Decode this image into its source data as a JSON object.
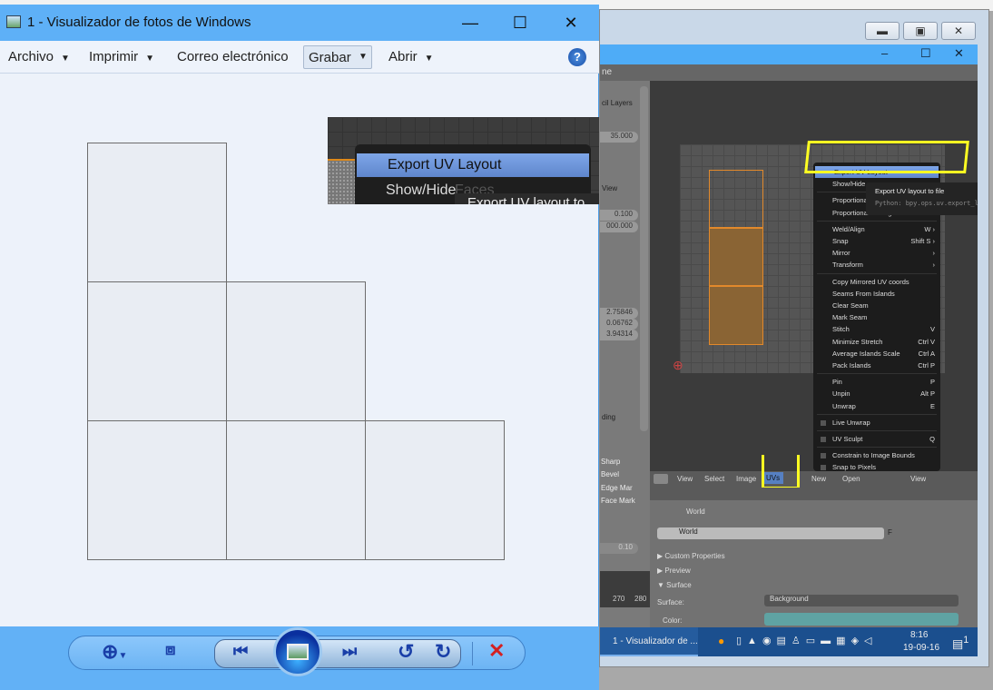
{
  "photo_viewer": {
    "title": "1 - Visualizador de fotos de Windows",
    "window_buttons": {
      "minimize": "—",
      "maximize": "☐",
      "close": "✕"
    },
    "menu": [
      {
        "label": "Archivo",
        "dropdown": true
      },
      {
        "label": "Imprimir",
        "dropdown": true
      },
      {
        "label": "Correo electrónico",
        "dropdown": false
      },
      {
        "label": "Grabar",
        "dropdown": true
      },
      {
        "label": "Abrir",
        "dropdown": true
      }
    ],
    "help": "?",
    "image_crop": {
      "highlighted_item": "Export UV Layout",
      "next_item": "Show/Hide",
      "faded_text": "Faces",
      "tooltip_fragment": "Export UV layout to fil"
    },
    "controls": [
      "zoom",
      "fit",
      "previous",
      "slideshow",
      "next",
      "rotate-left",
      "rotate-right",
      "delete"
    ]
  },
  "blender": {
    "header_fragment": "ne",
    "left_panel": {
      "labels": [
        "cil Layers",
        "View",
        "ding",
        "Sharp",
        "Bevel",
        "Edge Mar",
        "Face Mark"
      ],
      "values": [
        "35.000",
        "0.100",
        "000.000",
        "2.75846",
        "0.06762",
        "3.94314",
        "0.10"
      ]
    },
    "uv_menu": [
      {
        "label": "Export UV Layout",
        "shortcut": "",
        "highlighted": true
      },
      {
        "label": "Show/Hide",
        "shortcut": ""
      },
      {
        "label": "Proportional",
        "shortcut": ""
      },
      {
        "label": "Proportional Editing",
        "shortcut": ""
      },
      {
        "label": "Weld/Align",
        "shortcut": "W ›"
      },
      {
        "label": "Snap",
        "shortcut": "Shift S ›"
      },
      {
        "label": "Mirror",
        "shortcut": "›"
      },
      {
        "label": "Transform",
        "shortcut": "›"
      },
      {
        "label": "Copy Mirrored UV coords",
        "shortcut": ""
      },
      {
        "label": "Seams From Islands",
        "shortcut": ""
      },
      {
        "label": "Clear Seam",
        "shortcut": ""
      },
      {
        "label": "Mark Seam",
        "shortcut": ""
      },
      {
        "label": "Stitch",
        "shortcut": "V"
      },
      {
        "label": "Minimize Stretch",
        "shortcut": "Ctrl V"
      },
      {
        "label": "Average Islands Scale",
        "shortcut": "Ctrl A"
      },
      {
        "label": "Pack Islands",
        "shortcut": "Ctrl P"
      },
      {
        "label": "Pin",
        "shortcut": "P"
      },
      {
        "label": "Unpin",
        "shortcut": "Alt P"
      },
      {
        "label": "Unwrap",
        "shortcut": "E"
      },
      {
        "label": "Live Unwrap",
        "shortcut": "",
        "checkbox": true
      },
      {
        "label": "UV Sculpt",
        "shortcut": "Q",
        "checkbox": true
      },
      {
        "label": "Constrain to Image Bounds",
        "shortcut": "",
        "checkbox": true
      },
      {
        "label": "Snap to Pixels",
        "shortcut": "",
        "checkbox": true
      }
    ],
    "tooltip": {
      "title": "Export UV layout to file",
      "python": "Python: bpy.ops.uv.export_layout()"
    },
    "header": {
      "view": "View",
      "select": "Select",
      "image": "Image",
      "uvs": "UVs",
      "new": "New",
      "open": "Open",
      "view2": "View"
    },
    "properties": {
      "world_path": "World",
      "world_field": "World",
      "f": "F",
      "custom_properties": "▶ Custom Properties",
      "preview": "▶ Preview",
      "surface_section": "▼ Surface",
      "surface_label": "Surface:",
      "surface_value": "Background",
      "color_label": "Color:",
      "timeline": [
        "270",
        "280"
      ]
    },
    "highlight_color": "#ffff22"
  },
  "taskbar": {
    "task": "1 - Visualizador de ...",
    "time": "8:16",
    "date": "19-09-16",
    "notifications": "1"
  }
}
